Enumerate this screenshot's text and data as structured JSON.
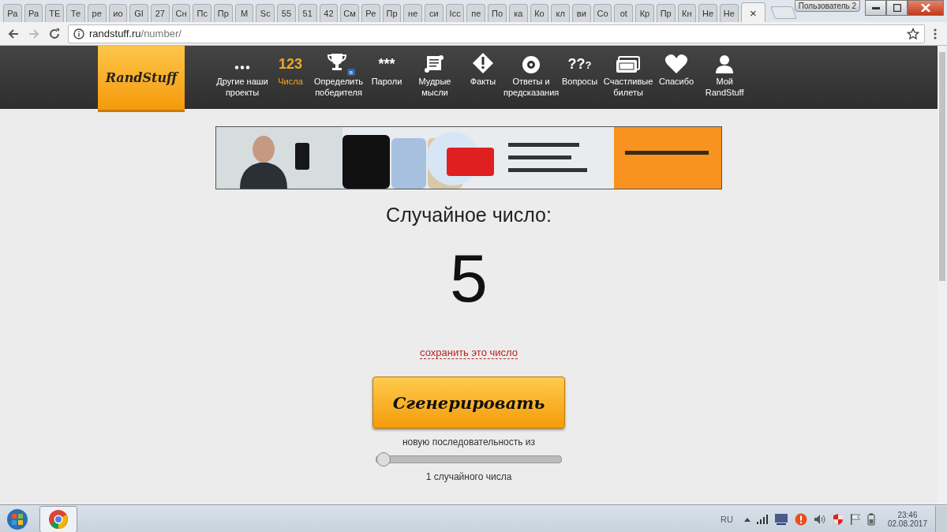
{
  "browser": {
    "tabs": [
      {
        "title": "Ра",
        "selected": false
      },
      {
        "title": "Ра",
        "selected": false
      },
      {
        "title": "TE",
        "selected": false
      },
      {
        "title": "Те",
        "selected": false
      },
      {
        "title": "ре",
        "selected": false
      },
      {
        "title": "ио",
        "selected": false
      },
      {
        "title": "GI",
        "selected": false
      },
      {
        "title": "27",
        "selected": false
      },
      {
        "title": "Сн",
        "selected": false
      },
      {
        "title": "Пс",
        "selected": false
      },
      {
        "title": "Пр",
        "selected": false
      },
      {
        "title": "М",
        "selected": false
      },
      {
        "title": "Sc",
        "selected": false
      },
      {
        "title": "55",
        "selected": false
      },
      {
        "title": "51",
        "selected": false
      },
      {
        "title": "42",
        "selected": false
      },
      {
        "title": "См",
        "selected": false
      },
      {
        "title": "Ре",
        "selected": false
      },
      {
        "title": "Пр",
        "selected": false
      },
      {
        "title": "не",
        "selected": false
      },
      {
        "title": "си",
        "selected": false
      },
      {
        "title": "Icc",
        "selected": false
      },
      {
        "title": "пе",
        "selected": false
      },
      {
        "title": "По",
        "selected": false
      },
      {
        "title": "ка",
        "selected": false
      },
      {
        "title": "Ко",
        "selected": false
      },
      {
        "title": "кл",
        "selected": false
      },
      {
        "title": "ви",
        "selected": false
      },
      {
        "title": "Со",
        "selected": false
      },
      {
        "title": "ot",
        "selected": false
      },
      {
        "title": "Кр",
        "selected": false
      },
      {
        "title": "Пр",
        "selected": false
      },
      {
        "title": "Кн",
        "selected": false
      },
      {
        "title": "Не",
        "selected": false
      },
      {
        "title": "Не",
        "selected": false
      },
      {
        "close": "×",
        "selected": true
      }
    ],
    "profile": "Пользователь 2",
    "url_host": "randstuff.ru",
    "url_path": "/number/"
  },
  "site": {
    "logo": "RandStuff",
    "nav": [
      {
        "label": "Другие наши проекты",
        "selected": false
      },
      {
        "glyph": "123",
        "label": "Числа",
        "selected": true
      },
      {
        "badge": "в",
        "label": "Определить победителя",
        "selected": false
      },
      {
        "glyph": "***",
        "label": "Пароли",
        "selected": false
      },
      {
        "label": "Мудрые мысли",
        "selected": false
      },
      {
        "label": "Факты",
        "selected": false
      },
      {
        "label": "Ответы и предсказания",
        "selected": false
      },
      {
        "glyph": "??",
        "glyph2": "?",
        "label": "Вопросы",
        "selected": false
      },
      {
        "label": "Счастливые билеты",
        "selected": false
      },
      {
        "label": "Спасибо",
        "selected": false
      },
      {
        "label": "Мой RandStuff",
        "selected": false
      }
    ],
    "heading": "Случайное число:",
    "number": "5",
    "save_link": "сохранить это число",
    "generate_button": "Сгенерировать",
    "sequence_label": "новую последовательность из",
    "slider": {
      "level": 0
    },
    "count_label": "1 случайного числа"
  },
  "taskbar": {
    "language": "RU",
    "time": "23:46",
    "date": "02.08.2017"
  }
}
